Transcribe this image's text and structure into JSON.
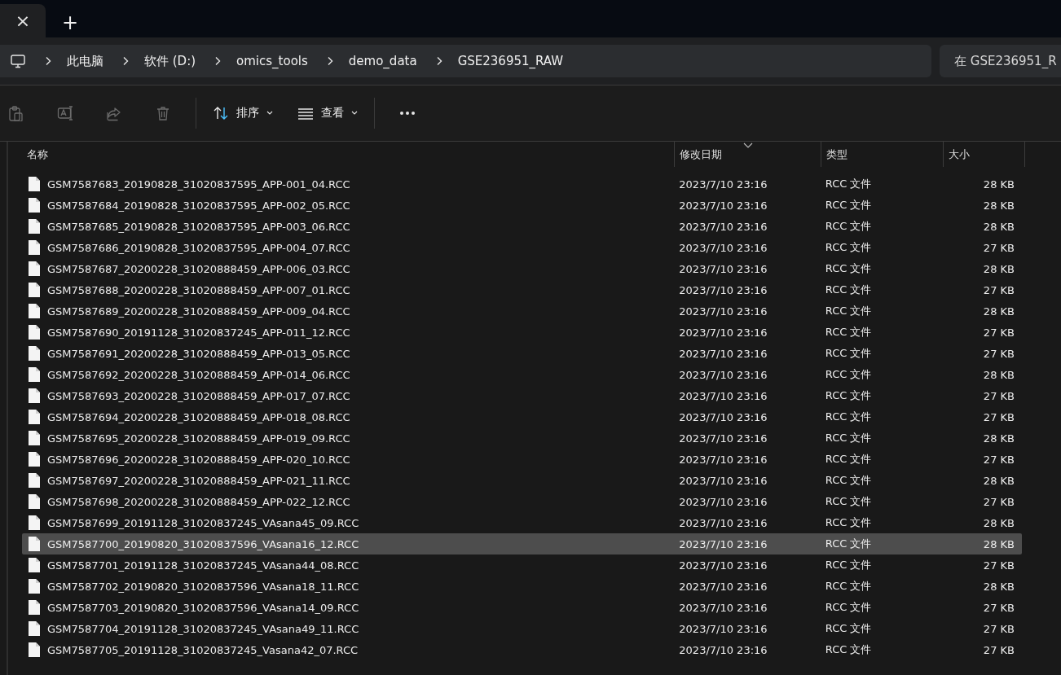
{
  "tabs": {
    "close_label": "×",
    "new_label": "+"
  },
  "address_bar": {
    "breadcrumbs": [
      "此电脑",
      "软件 (D:)",
      "omics_tools",
      "demo_data",
      "GSE236951_RAW"
    ]
  },
  "search": {
    "placeholder": "在 GSE236951_R"
  },
  "toolbar": {
    "actions": [
      {
        "kind": "paste",
        "disabled": true
      },
      {
        "kind": "rename",
        "disabled": true
      },
      {
        "kind": "share",
        "disabled": true
      },
      {
        "kind": "delete",
        "disabled": true
      },
      {
        "kind": "sort",
        "label": "排序",
        "disabled": false
      },
      {
        "kind": "view",
        "label": "查看",
        "disabled": false
      },
      {
        "kind": "more",
        "disabled": false
      }
    ]
  },
  "table": {
    "columns": [
      {
        "label": "名称",
        "sorted": false
      },
      {
        "label": "修改日期",
        "sorted": true
      },
      {
        "label": "类型",
        "sorted": false
      },
      {
        "label": "大小",
        "sorted": false
      }
    ],
    "rows": [
      {
        "name": "GSM7587683_20190828_31020837595_APP-001_04.RCC",
        "modified": "2023/7/10 23:16",
        "type": "RCC 文件",
        "size": "28 KB",
        "selected": false
      },
      {
        "name": "GSM7587684_20190828_31020837595_APP-002_05.RCC",
        "modified": "2023/7/10 23:16",
        "type": "RCC 文件",
        "size": "28 KB",
        "selected": false
      },
      {
        "name": "GSM7587685_20190828_31020837595_APP-003_06.RCC",
        "modified": "2023/7/10 23:16",
        "type": "RCC 文件",
        "size": "28 KB",
        "selected": false
      },
      {
        "name": "GSM7587686_20190828_31020837595_APP-004_07.RCC",
        "modified": "2023/7/10 23:16",
        "type": "RCC 文件",
        "size": "27 KB",
        "selected": false
      },
      {
        "name": "GSM7587687_20200228_31020888459_APP-006_03.RCC",
        "modified": "2023/7/10 23:16",
        "type": "RCC 文件",
        "size": "28 KB",
        "selected": false
      },
      {
        "name": "GSM7587688_20200228_31020888459_APP-007_01.RCC",
        "modified": "2023/7/10 23:16",
        "type": "RCC 文件",
        "size": "27 KB",
        "selected": false
      },
      {
        "name": "GSM7587689_20200228_31020888459_APP-009_04.RCC",
        "modified": "2023/7/10 23:16",
        "type": "RCC 文件",
        "size": "28 KB",
        "selected": false
      },
      {
        "name": "GSM7587690_20191128_31020837245_APP-011_12.RCC",
        "modified": "2023/7/10 23:16",
        "type": "RCC 文件",
        "size": "27 KB",
        "selected": false
      },
      {
        "name": "GSM7587691_20200228_31020888459_APP-013_05.RCC",
        "modified": "2023/7/10 23:16",
        "type": "RCC 文件",
        "size": "27 KB",
        "selected": false
      },
      {
        "name": "GSM7587692_20200228_31020888459_APP-014_06.RCC",
        "modified": "2023/7/10 23:16",
        "type": "RCC 文件",
        "size": "28 KB",
        "selected": false
      },
      {
        "name": "GSM7587693_20200228_31020888459_APP-017_07.RCC",
        "modified": "2023/7/10 23:16",
        "type": "RCC 文件",
        "size": "27 KB",
        "selected": false
      },
      {
        "name": "GSM7587694_20200228_31020888459_APP-018_08.RCC",
        "modified": "2023/7/10 23:16",
        "type": "RCC 文件",
        "size": "27 KB",
        "selected": false
      },
      {
        "name": "GSM7587695_20200228_31020888459_APP-019_09.RCC",
        "modified": "2023/7/10 23:16",
        "type": "RCC 文件",
        "size": "28 KB",
        "selected": false
      },
      {
        "name": "GSM7587696_20200228_31020888459_APP-020_10.RCC",
        "modified": "2023/7/10 23:16",
        "type": "RCC 文件",
        "size": "27 KB",
        "selected": false
      },
      {
        "name": "GSM7587697_20200228_31020888459_APP-021_11.RCC",
        "modified": "2023/7/10 23:16",
        "type": "RCC 文件",
        "size": "28 KB",
        "selected": false
      },
      {
        "name": "GSM7587698_20200228_31020888459_APP-022_12.RCC",
        "modified": "2023/7/10 23:16",
        "type": "RCC 文件",
        "size": "27 KB",
        "selected": false
      },
      {
        "name": "GSM7587699_20191128_31020837245_VAsana45_09.RCC",
        "modified": "2023/7/10 23:16",
        "type": "RCC 文件",
        "size": "28 KB",
        "selected": false
      },
      {
        "name": "GSM7587700_20190820_31020837596_VAsana16_12.RCC",
        "modified": "2023/7/10 23:16",
        "type": "RCC 文件",
        "size": "28 KB",
        "selected": true
      },
      {
        "name": "GSM7587701_20191128_31020837245_VAsana44_08.RCC",
        "modified": "2023/7/10 23:16",
        "type": "RCC 文件",
        "size": "27 KB",
        "selected": false
      },
      {
        "name": "GSM7587702_20190820_31020837596_VAsana18_11.RCC",
        "modified": "2023/7/10 23:16",
        "type": "RCC 文件",
        "size": "28 KB",
        "selected": false
      },
      {
        "name": "GSM7587703_20190820_31020837596_VAsana14_09.RCC",
        "modified": "2023/7/10 23:16",
        "type": "RCC 文件",
        "size": "27 KB",
        "selected": false
      },
      {
        "name": "GSM7587704_20191128_31020837245_VAsana49_11.RCC",
        "modified": "2023/7/10 23:16",
        "type": "RCC 文件",
        "size": "27 KB",
        "selected": false
      },
      {
        "name": "GSM7587705_20191128_31020837245_Vasana42_07.RCC",
        "modified": "2023/7/10 23:16",
        "type": "RCC 文件",
        "size": "27 KB",
        "selected": false
      }
    ]
  }
}
